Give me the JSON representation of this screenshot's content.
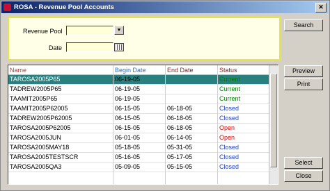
{
  "window": {
    "title": "ROSA - Revenue Pool Accounts"
  },
  "filter": {
    "revenue_pool_label": "Revenue Pool",
    "revenue_pool_value": "",
    "date_label": "Date",
    "date_value": ""
  },
  "buttons": {
    "search": "Search",
    "preview": "Preview",
    "print": "Print",
    "select": "Select",
    "close": "Close"
  },
  "grid": {
    "columns": [
      "Name",
      "Begin Date",
      "End Date",
      "Status"
    ],
    "header_colors": {
      "name": "#c0392b",
      "begin": "#1e6fd9",
      "end": "#8b1a1a",
      "status": "#8b1a1a"
    },
    "selected_row_index": 0,
    "rows": [
      {
        "name": "TAROSA2005P65",
        "begin": "06-19-05",
        "end": "",
        "status": "Current"
      },
      {
        "name": "TADREW2005P65",
        "begin": "06-19-05",
        "end": "",
        "status": "Current"
      },
      {
        "name": "TAAMIT2005P65",
        "begin": "06-19-05",
        "end": "",
        "status": "Current"
      },
      {
        "name": "TAAMIT2005P62005",
        "begin": "06-15-05",
        "end": "06-18-05",
        "status": "Closed"
      },
      {
        "name": "TADREW2005P62005",
        "begin": "06-15-05",
        "end": "06-18-05",
        "status": "Closed"
      },
      {
        "name": "TAROSA2005P62005",
        "begin": "06-15-05",
        "end": "06-18-05",
        "status": "Open"
      },
      {
        "name": "TAROSA2005JUN",
        "begin": "06-01-05",
        "end": "06-14-05",
        "status": "Open"
      },
      {
        "name": "TAROSA2005MAY18",
        "begin": "05-18-05",
        "end": "05-31-05",
        "status": "Closed"
      },
      {
        "name": "TAROSA2005TESTSCR",
        "begin": "05-16-05",
        "end": "05-17-05",
        "status": "Closed"
      },
      {
        "name": "TAROSA2005QA3",
        "begin": "05-09-05",
        "end": "05-15-05",
        "status": "Closed"
      }
    ]
  },
  "status_colors": {
    "Current": "#008000",
    "Closed": "#1f3fbf",
    "Open": "#d00000"
  }
}
